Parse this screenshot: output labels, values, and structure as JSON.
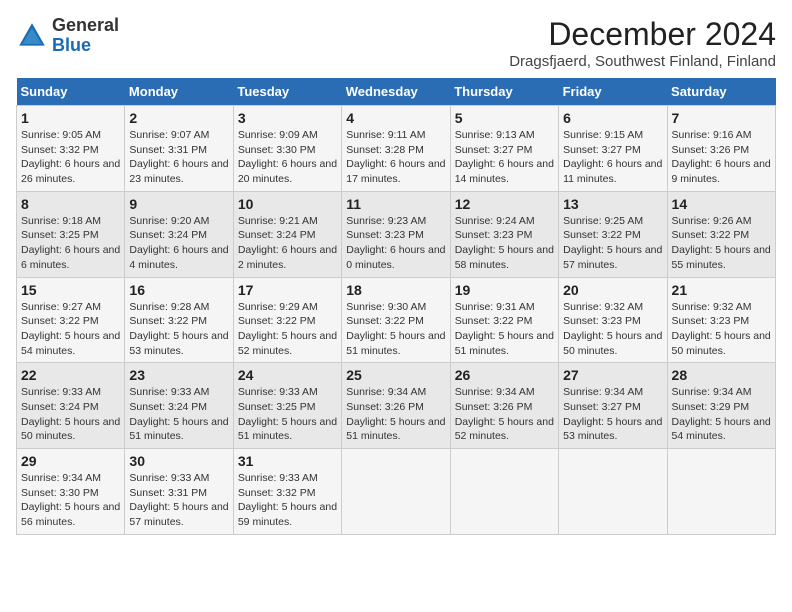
{
  "header": {
    "logo_line1": "General",
    "logo_line2": "Blue",
    "title": "December 2024",
    "subtitle": "Dragsfjaerd, Southwest Finland, Finland"
  },
  "calendar": {
    "days_of_week": [
      "Sunday",
      "Monday",
      "Tuesday",
      "Wednesday",
      "Thursday",
      "Friday",
      "Saturday"
    ],
    "weeks": [
      [
        {
          "day": "1",
          "sunrise": "Sunrise: 9:05 AM",
          "sunset": "Sunset: 3:32 PM",
          "daylight": "Daylight: 6 hours and 26 minutes."
        },
        {
          "day": "2",
          "sunrise": "Sunrise: 9:07 AM",
          "sunset": "Sunset: 3:31 PM",
          "daylight": "Daylight: 6 hours and 23 minutes."
        },
        {
          "day": "3",
          "sunrise": "Sunrise: 9:09 AM",
          "sunset": "Sunset: 3:30 PM",
          "daylight": "Daylight: 6 hours and 20 minutes."
        },
        {
          "day": "4",
          "sunrise": "Sunrise: 9:11 AM",
          "sunset": "Sunset: 3:28 PM",
          "daylight": "Daylight: 6 hours and 17 minutes."
        },
        {
          "day": "5",
          "sunrise": "Sunrise: 9:13 AM",
          "sunset": "Sunset: 3:27 PM",
          "daylight": "Daylight: 6 hours and 14 minutes."
        },
        {
          "day": "6",
          "sunrise": "Sunrise: 9:15 AM",
          "sunset": "Sunset: 3:27 PM",
          "daylight": "Daylight: 6 hours and 11 minutes."
        },
        {
          "day": "7",
          "sunrise": "Sunrise: 9:16 AM",
          "sunset": "Sunset: 3:26 PM",
          "daylight": "Daylight: 6 hours and 9 minutes."
        }
      ],
      [
        {
          "day": "8",
          "sunrise": "Sunrise: 9:18 AM",
          "sunset": "Sunset: 3:25 PM",
          "daylight": "Daylight: 6 hours and 6 minutes."
        },
        {
          "day": "9",
          "sunrise": "Sunrise: 9:20 AM",
          "sunset": "Sunset: 3:24 PM",
          "daylight": "Daylight: 6 hours and 4 minutes."
        },
        {
          "day": "10",
          "sunrise": "Sunrise: 9:21 AM",
          "sunset": "Sunset: 3:24 PM",
          "daylight": "Daylight: 6 hours and 2 minutes."
        },
        {
          "day": "11",
          "sunrise": "Sunrise: 9:23 AM",
          "sunset": "Sunset: 3:23 PM",
          "daylight": "Daylight: 6 hours and 0 minutes."
        },
        {
          "day": "12",
          "sunrise": "Sunrise: 9:24 AM",
          "sunset": "Sunset: 3:23 PM",
          "daylight": "Daylight: 5 hours and 58 minutes."
        },
        {
          "day": "13",
          "sunrise": "Sunrise: 9:25 AM",
          "sunset": "Sunset: 3:22 PM",
          "daylight": "Daylight: 5 hours and 57 minutes."
        },
        {
          "day": "14",
          "sunrise": "Sunrise: 9:26 AM",
          "sunset": "Sunset: 3:22 PM",
          "daylight": "Daylight: 5 hours and 55 minutes."
        }
      ],
      [
        {
          "day": "15",
          "sunrise": "Sunrise: 9:27 AM",
          "sunset": "Sunset: 3:22 PM",
          "daylight": "Daylight: 5 hours and 54 minutes."
        },
        {
          "day": "16",
          "sunrise": "Sunrise: 9:28 AM",
          "sunset": "Sunset: 3:22 PM",
          "daylight": "Daylight: 5 hours and 53 minutes."
        },
        {
          "day": "17",
          "sunrise": "Sunrise: 9:29 AM",
          "sunset": "Sunset: 3:22 PM",
          "daylight": "Daylight: 5 hours and 52 minutes."
        },
        {
          "day": "18",
          "sunrise": "Sunrise: 9:30 AM",
          "sunset": "Sunset: 3:22 PM",
          "daylight": "Daylight: 5 hours and 51 minutes."
        },
        {
          "day": "19",
          "sunrise": "Sunrise: 9:31 AM",
          "sunset": "Sunset: 3:22 PM",
          "daylight": "Daylight: 5 hours and 51 minutes."
        },
        {
          "day": "20",
          "sunrise": "Sunrise: 9:32 AM",
          "sunset": "Sunset: 3:23 PM",
          "daylight": "Daylight: 5 hours and 50 minutes."
        },
        {
          "day": "21",
          "sunrise": "Sunrise: 9:32 AM",
          "sunset": "Sunset: 3:23 PM",
          "daylight": "Daylight: 5 hours and 50 minutes."
        }
      ],
      [
        {
          "day": "22",
          "sunrise": "Sunrise: 9:33 AM",
          "sunset": "Sunset: 3:24 PM",
          "daylight": "Daylight: 5 hours and 50 minutes."
        },
        {
          "day": "23",
          "sunrise": "Sunrise: 9:33 AM",
          "sunset": "Sunset: 3:24 PM",
          "daylight": "Daylight: 5 hours and 51 minutes."
        },
        {
          "day": "24",
          "sunrise": "Sunrise: 9:33 AM",
          "sunset": "Sunset: 3:25 PM",
          "daylight": "Daylight: 5 hours and 51 minutes."
        },
        {
          "day": "25",
          "sunrise": "Sunrise: 9:34 AM",
          "sunset": "Sunset: 3:26 PM",
          "daylight": "Daylight: 5 hours and 51 minutes."
        },
        {
          "day": "26",
          "sunrise": "Sunrise: 9:34 AM",
          "sunset": "Sunset: 3:26 PM",
          "daylight": "Daylight: 5 hours and 52 minutes."
        },
        {
          "day": "27",
          "sunrise": "Sunrise: 9:34 AM",
          "sunset": "Sunset: 3:27 PM",
          "daylight": "Daylight: 5 hours and 53 minutes."
        },
        {
          "day": "28",
          "sunrise": "Sunrise: 9:34 AM",
          "sunset": "Sunset: 3:29 PM",
          "daylight": "Daylight: 5 hours and 54 minutes."
        }
      ],
      [
        {
          "day": "29",
          "sunrise": "Sunrise: 9:34 AM",
          "sunset": "Sunset: 3:30 PM",
          "daylight": "Daylight: 5 hours and 56 minutes."
        },
        {
          "day": "30",
          "sunrise": "Sunrise: 9:33 AM",
          "sunset": "Sunset: 3:31 PM",
          "daylight": "Daylight: 5 hours and 57 minutes."
        },
        {
          "day": "31",
          "sunrise": "Sunrise: 9:33 AM",
          "sunset": "Sunset: 3:32 PM",
          "daylight": "Daylight: 5 hours and 59 minutes."
        },
        null,
        null,
        null,
        null
      ]
    ]
  }
}
